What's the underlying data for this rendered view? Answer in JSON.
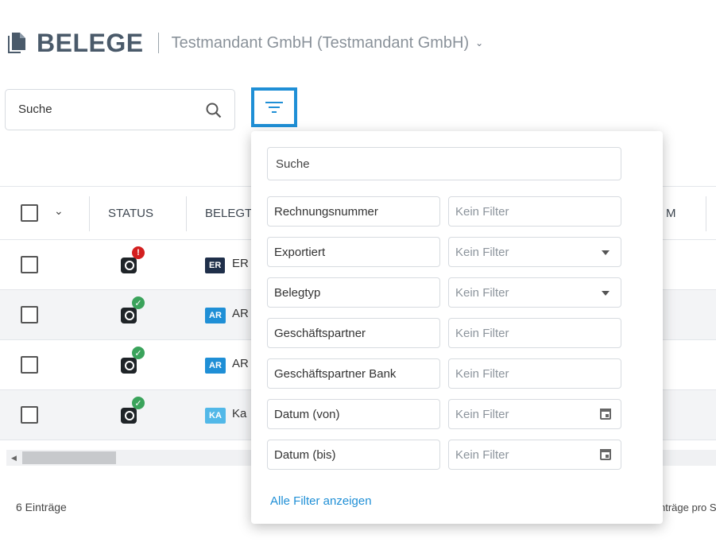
{
  "header": {
    "title": "BELEGE",
    "tenant": "Testmandant GmbH (Testmandant GmbH)"
  },
  "search": {
    "placeholder": "Suche"
  },
  "table": {
    "columns": [
      "STATUS",
      "BELEGT",
      "M"
    ],
    "rows": [
      {
        "status": "error",
        "status_mark": "!",
        "tag": "ER",
        "tag_color": "#1f2f4a",
        "text": "ER"
      },
      {
        "status": "ok",
        "status_mark": "✓",
        "tag": "AR",
        "tag_color": "#1f8fd6",
        "text": "AR"
      },
      {
        "status": "ok",
        "status_mark": "✓",
        "tag": "AR",
        "tag_color": "#1f8fd6",
        "text": "AR"
      },
      {
        "status": "ok",
        "status_mark": "✓",
        "tag": "KA",
        "tag_color": "#52b8e8",
        "text": "Ka"
      }
    ]
  },
  "footer": {
    "entries": "6 Einträge",
    "per_page": "nträge pro S"
  },
  "filter_popup": {
    "search_placeholder": "Suche",
    "filters": [
      {
        "label": "Rechnungsnummer",
        "value": "Kein Filter",
        "control": "text"
      },
      {
        "label": "Exportiert",
        "value": "Kein Filter",
        "control": "dropdown"
      },
      {
        "label": "Belegtyp",
        "value": "Kein Filter",
        "control": "dropdown"
      },
      {
        "label": "Geschäftspartner",
        "value": "Kein Filter",
        "control": "text"
      },
      {
        "label": "Geschäftspartner Bank",
        "value": "Kein Filter",
        "control": "text"
      },
      {
        "label": "Datum (von)",
        "value": "Kein Filter",
        "control": "date"
      },
      {
        "label": "Datum (bis)",
        "value": "Kein Filter",
        "control": "date"
      }
    ],
    "show_all": "Alle Filter anzeigen"
  },
  "colors": {
    "accent": "#1f8fd6",
    "title": "#4a5a6a",
    "error": "#d31f1f",
    "ok": "#3aa35b"
  },
  "icons": [
    "documents-icon",
    "chevron-down-icon",
    "search-icon",
    "filter-icon",
    "calendar-icon"
  ]
}
